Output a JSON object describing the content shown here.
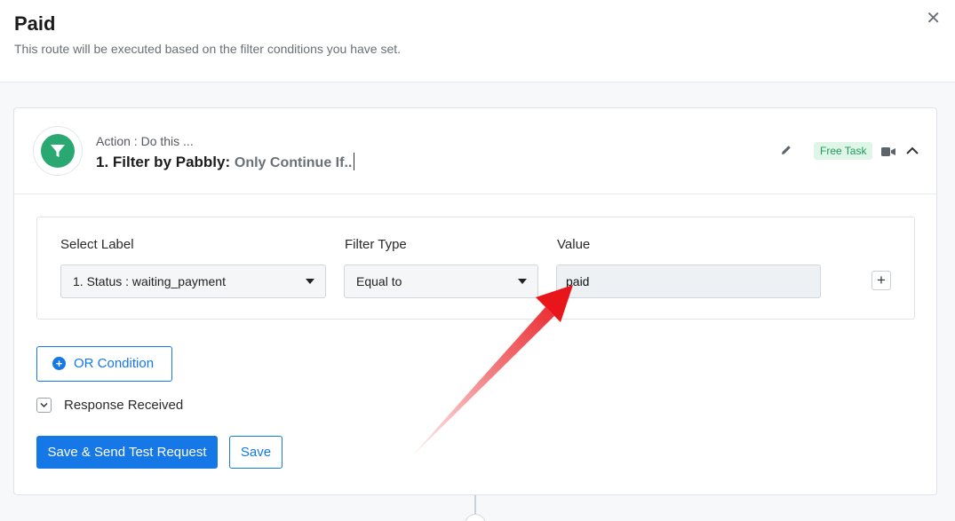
{
  "header": {
    "title": "Paid",
    "subtitle": "This route will be executed based on the filter conditions you have set."
  },
  "action": {
    "subtitle": "Action : Do this ...",
    "title": "1. Filter by Pabbly:",
    "description": "Only Continue If..",
    "badge": "Free Task"
  },
  "filter": {
    "select_label": "Select Label",
    "filter_type_label": "Filter Type",
    "value_label": "Value",
    "select_value": "1. Status : waiting_payment",
    "filter_type_value": "Equal to",
    "value": "paid",
    "add_symbol": "+"
  },
  "buttons": {
    "or_condition": "OR Condition",
    "save_send": "Save & Send Test Request",
    "save": "Save"
  },
  "response": {
    "label": "Response Received"
  },
  "colors": {
    "accent": "#1677e6",
    "filter_icon": "#2aa871",
    "badge_bg": "#dff5e8",
    "badge_text": "#1f9a5b",
    "annotation_arrow": "#e8151b"
  }
}
